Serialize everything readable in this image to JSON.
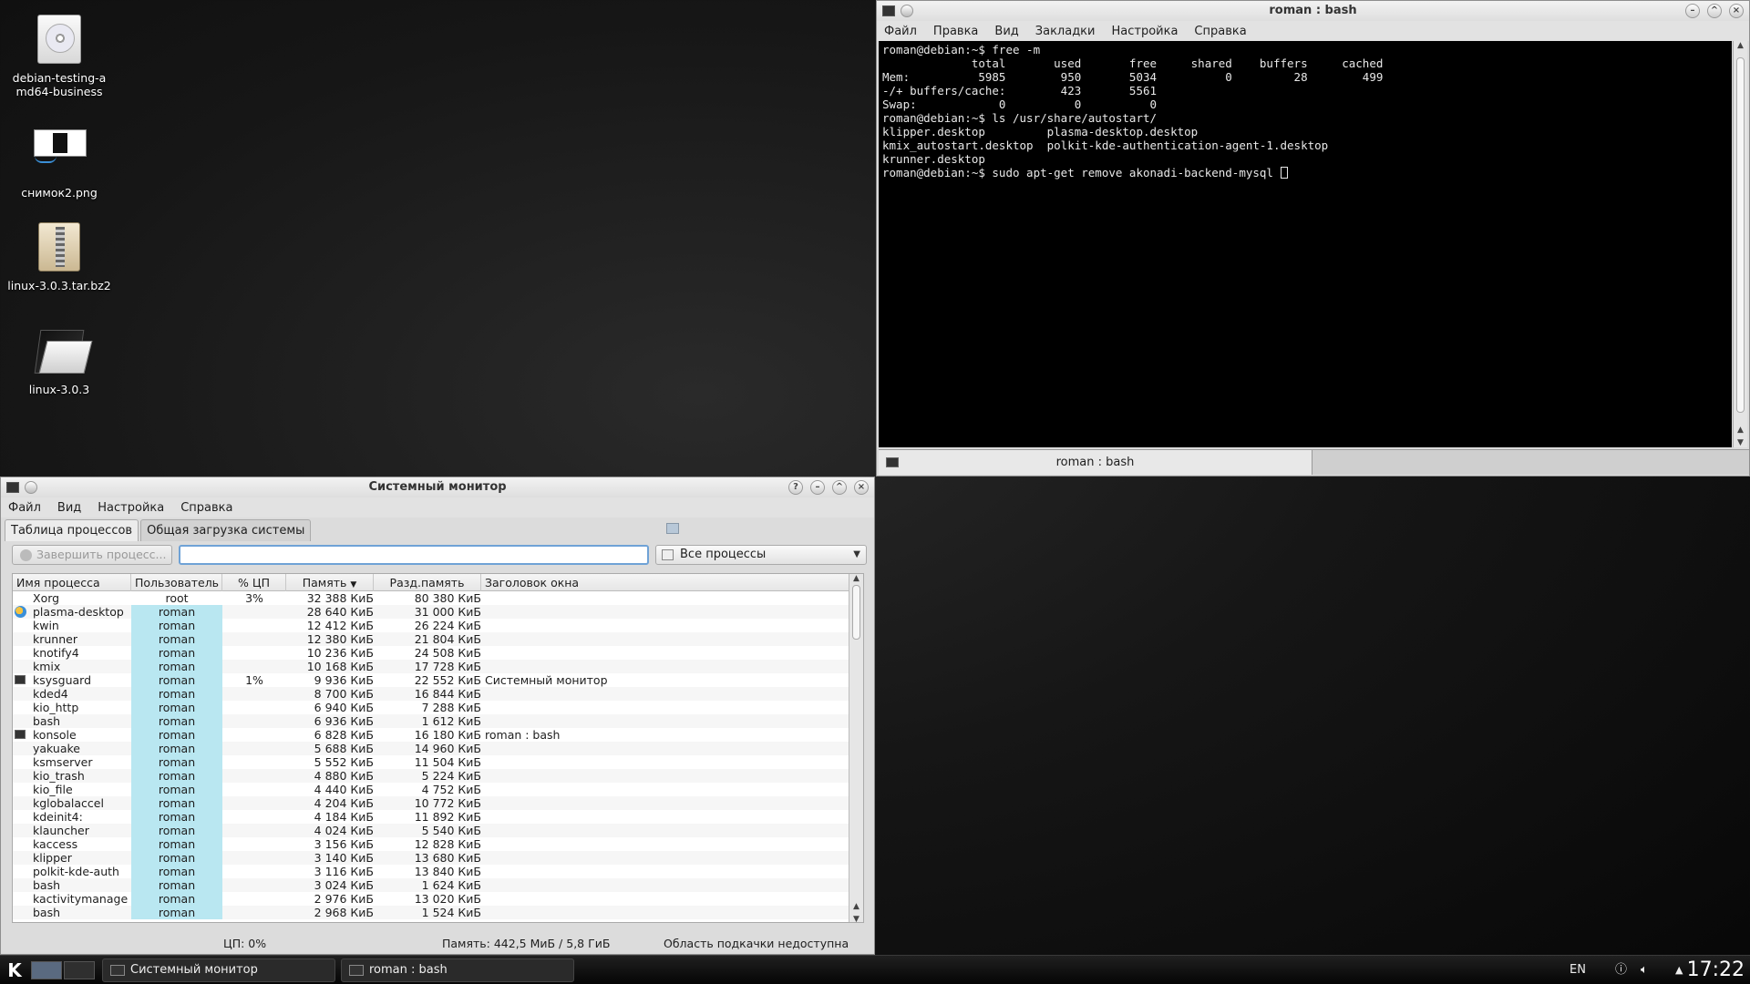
{
  "desktop_icons": [
    {
      "label": "debian-testing-amd64-business",
      "icon": "disc-image-icon"
    },
    {
      "label": "снимок2.png",
      "icon": "png-image-icon"
    },
    {
      "label": "linux-3.0.3.tar.bz2",
      "icon": "archive-icon"
    },
    {
      "label": "linux-3.0.3",
      "icon": "folder-icon"
    }
  ],
  "terminal": {
    "title": "roman : bash",
    "menu": [
      "Файл",
      "Правка",
      "Вид",
      "Закладки",
      "Настройка",
      "Справка"
    ],
    "lines": [
      "roman@debian:~$ free -m",
      "             total       used       free     shared    buffers     cached",
      "Mem:          5985        950       5034          0         28        499",
      "-/+ buffers/cache:        423       5561",
      "Swap:            0          0          0",
      "roman@debian:~$ ls /usr/share/autostart/",
      "klipper.desktop         plasma-desktop.desktop",
      "kmix_autostart.desktop  polkit-kde-authentication-agent-1.desktop",
      "krunner.desktop"
    ],
    "prompt_line": "roman@debian:~$ sudo apt-get remove akonadi-backend-mysql ",
    "tab_label": "roman : bash"
  },
  "sysmon": {
    "title": "Системный монитор",
    "menu": [
      "Файл",
      "Вид",
      "Настройка",
      "Справка"
    ],
    "tabs": [
      "Таблица процессов",
      "Общая загрузка системы"
    ],
    "kill_button": "Завершить процесс...",
    "filter_value": "",
    "filter_select": "Все процессы",
    "columns": [
      "Имя процесса",
      "Пользователь",
      "% ЦП",
      "Память",
      "Разд.память",
      "Заголовок окна"
    ],
    "rows": [
      {
        "icon": "",
        "name": "Xorg",
        "user": "root",
        "cpu": "3%",
        "mem": "32 388 КиБ",
        "shm": "80 380 КиБ",
        "win": ""
      },
      {
        "icon": "plasma",
        "name": "plasma-desktop",
        "user": "roman",
        "cpu": "",
        "mem": "28 640 КиБ",
        "shm": "31 000 КиБ",
        "win": ""
      },
      {
        "icon": "",
        "name": "kwin",
        "user": "roman",
        "cpu": "",
        "mem": "12 412 КиБ",
        "shm": "26 224 КиБ",
        "win": ""
      },
      {
        "icon": "",
        "name": "krunner",
        "user": "roman",
        "cpu": "",
        "mem": "12 380 КиБ",
        "shm": "21 804 КиБ",
        "win": ""
      },
      {
        "icon": "",
        "name": "knotify4",
        "user": "roman",
        "cpu": "",
        "mem": "10 236 КиБ",
        "shm": "24 508 КиБ",
        "win": ""
      },
      {
        "icon": "",
        "name": "kmix",
        "user": "roman",
        "cpu": "",
        "mem": "10 168 КиБ",
        "shm": "17 728 КиБ",
        "win": ""
      },
      {
        "icon": "monitor",
        "name": "ksysguard",
        "user": "roman",
        "cpu": "1%",
        "mem": "9 936 КиБ",
        "shm": "22 552 КиБ",
        "win": "Системный монитор"
      },
      {
        "icon": "",
        "name": "kded4",
        "user": "roman",
        "cpu": "",
        "mem": "8 700 КиБ",
        "shm": "16 844 КиБ",
        "win": ""
      },
      {
        "icon": "",
        "name": "kio_http",
        "user": "roman",
        "cpu": "",
        "mem": "6 940 КиБ",
        "shm": "7 288 КиБ",
        "win": ""
      },
      {
        "icon": "",
        "name": "bash",
        "user": "roman",
        "cpu": "",
        "mem": "6 936 КиБ",
        "shm": "1 612 КиБ",
        "win": ""
      },
      {
        "icon": "terminal",
        "name": "konsole",
        "user": "roman",
        "cpu": "",
        "mem": "6 828 КиБ",
        "shm": "16 180 КиБ",
        "win": "roman : bash"
      },
      {
        "icon": "",
        "name": "yakuake",
        "user": "roman",
        "cpu": "",
        "mem": "5 688 КиБ",
        "shm": "14 960 КиБ",
        "win": ""
      },
      {
        "icon": "",
        "name": "ksmserver",
        "user": "roman",
        "cpu": "",
        "mem": "5 552 КиБ",
        "shm": "11 504 КиБ",
        "win": ""
      },
      {
        "icon": "",
        "name": "kio_trash",
        "user": "roman",
        "cpu": "",
        "mem": "4 880 КиБ",
        "shm": "5 224 КиБ",
        "win": ""
      },
      {
        "icon": "",
        "name": "kio_file",
        "user": "roman",
        "cpu": "",
        "mem": "4 440 КиБ",
        "shm": "4 752 КиБ",
        "win": ""
      },
      {
        "icon": "",
        "name": "kglobalaccel",
        "user": "roman",
        "cpu": "",
        "mem": "4 204 КиБ",
        "shm": "10 772 КиБ",
        "win": ""
      },
      {
        "icon": "",
        "name": "kdeinit4:",
        "user": "roman",
        "cpu": "",
        "mem": "4 184 КиБ",
        "shm": "11 892 КиБ",
        "win": ""
      },
      {
        "icon": "",
        "name": "klauncher",
        "user": "roman",
        "cpu": "",
        "mem": "4 024 КиБ",
        "shm": "5 540 КиБ",
        "win": ""
      },
      {
        "icon": "",
        "name": "kaccess",
        "user": "roman",
        "cpu": "",
        "mem": "3 156 КиБ",
        "shm": "12 828 КиБ",
        "win": ""
      },
      {
        "icon": "",
        "name": "klipper",
        "user": "roman",
        "cpu": "",
        "mem": "3 140 КиБ",
        "shm": "13 680 КиБ",
        "win": ""
      },
      {
        "icon": "",
        "name": "polkit-kde-auth",
        "user": "roman",
        "cpu": "",
        "mem": "3 116 КиБ",
        "shm": "13 840 КиБ",
        "win": ""
      },
      {
        "icon": "",
        "name": "bash",
        "user": "roman",
        "cpu": "",
        "mem": "3 024 КиБ",
        "shm": "1 624 КиБ",
        "win": ""
      },
      {
        "icon": "",
        "name": "kactivitymanage",
        "user": "roman",
        "cpu": "",
        "mem": "2 976 КиБ",
        "shm": "13 020 КиБ",
        "win": ""
      },
      {
        "icon": "",
        "name": "bash",
        "user": "roman",
        "cpu": "",
        "mem": "2 968 КиБ",
        "shm": "1 524 КиБ",
        "win": ""
      }
    ],
    "status": {
      "cpu": "ЦП: 0%",
      "memory": "Память: 442,5 МиБ / 5,8 ГиБ",
      "swap": "Область подкачки недоступна"
    }
  },
  "taskbar": {
    "tasks": [
      "Системный монитор",
      "roman : bash"
    ],
    "layout": "EN",
    "clock": "17:22"
  }
}
